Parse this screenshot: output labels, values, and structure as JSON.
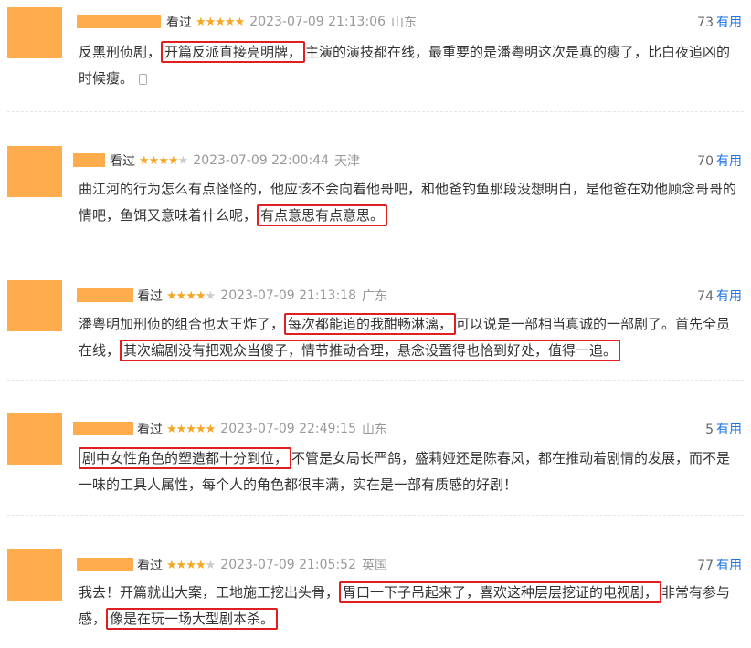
{
  "reviews": [
    {
      "status": "看过",
      "rating": 5,
      "date": "2023-07-09 21:13:06",
      "location": "山东",
      "useful_count": "73",
      "useful_label": "有用",
      "text": {
        "p1": "反黑刑侦剧，",
        "h1": "开篇反派直接亮明牌，",
        "p2": "主演的演技都在线，最重要的是潘粤明这次是真的瘦了，比白夜追凶的时候瘦。"
      }
    },
    {
      "status": "看过",
      "rating": 4,
      "date": "2023-07-09 22:00:44",
      "location": "天津",
      "useful_count": "70",
      "useful_label": "有用",
      "text": {
        "p1": "曲江河的行为怎么有点怪怪的，他应该不会向着他哥吧，和他爸钓鱼那段没想明白，是他爸在劝他顾念哥哥的情吧，鱼饵又意味着什么呢，",
        "h1": "有点意思有点意思。"
      }
    },
    {
      "status": "看过",
      "rating": 4,
      "date": "2023-07-09 21:13:18",
      "location": "广东",
      "useful_count": "74",
      "useful_label": "有用",
      "text": {
        "p1": "潘粤明加刑侦的组合也太王炸了，",
        "h1": "每次都能追的我酣畅淋漓，",
        "p2": "可以说是一部相当真诚的一部剧了。首先全员在线，",
        "h2": "其次编剧没有把观众当傻子，情节推动合理，悬念设置得也恰到好处，值得一追。"
      }
    },
    {
      "status": "看过",
      "rating": 5,
      "date": "2023-07-09 22:49:15",
      "location": "山东",
      "useful_count": "5",
      "useful_label": "有用",
      "text": {
        "h1": "剧中女性角色的塑造都十分到位，",
        "p1": "不管是女局长严鸽，盛莉娅还是陈春凤，都在推动着剧情的发展，而不是一味的工具人属性，每个人的角色都很丰满，实在是一部有质感的好剧！"
      }
    },
    {
      "status": "看过",
      "rating": 4,
      "date": "2023-07-09 21:05:52",
      "location": "英国",
      "useful_count": "77",
      "useful_label": "有用",
      "text": {
        "p1": "我去！开篇就出大案，工地施工挖出头骨，",
        "h1": "胃口一下子吊起来了，喜欢这种层层挖证的电视剧，",
        "p2": "非常有参与感，",
        "h2": "像是在玩一场大型剧本杀。"
      }
    }
  ]
}
